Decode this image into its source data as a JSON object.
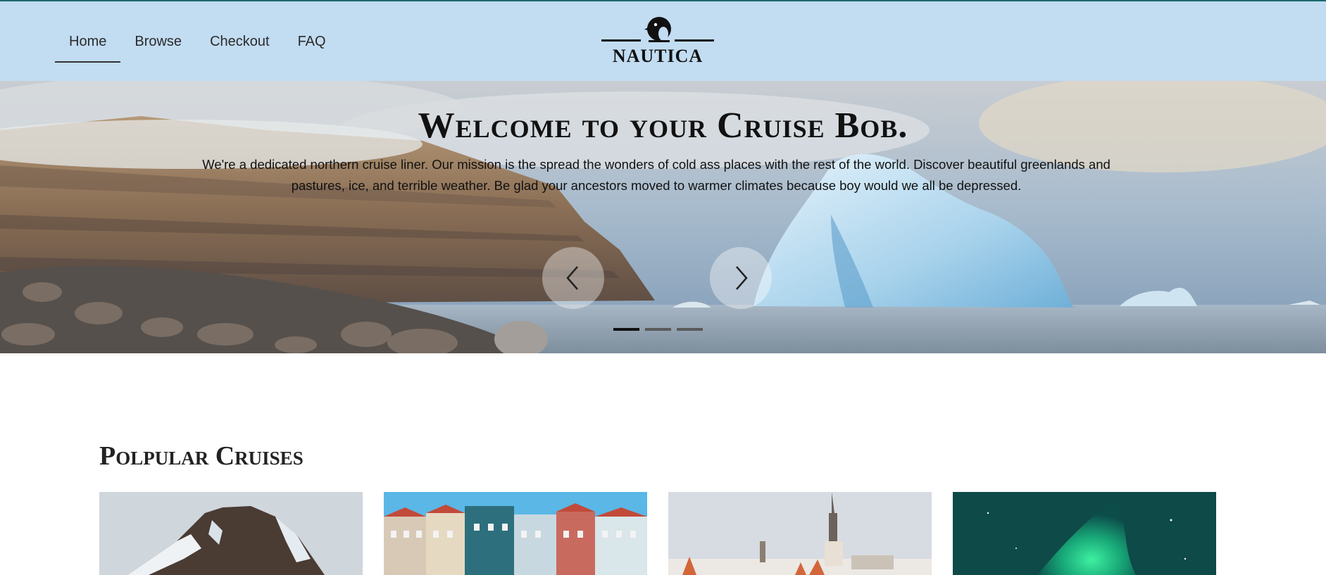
{
  "nav": {
    "items": [
      {
        "label": "Home",
        "active": true
      },
      {
        "label": "Browse",
        "active": false
      },
      {
        "label": "Checkout",
        "active": false
      },
      {
        "label": "FAQ",
        "active": false
      }
    ]
  },
  "logo": {
    "text": "NAUTICA",
    "icon": "penguin-logo-icon"
  },
  "hero": {
    "title": "Welcome to your Cruise Bob.",
    "text": "We're a dedicated northern cruise liner. Our mission is the spread the wonders of cold ass places with the rest of the world. Discover beautiful greenlands and pastures, ice, and terrible weather. Be glad your ancestors moved to warmer climates because boy would we all be depressed.",
    "prev_icon": "chevron-left-icon",
    "next_icon": "chevron-right-icon",
    "slides_count": 3,
    "active_slide": 1
  },
  "popular": {
    "title": "Polpular Cruises",
    "cards": [
      {
        "image": "snowy-mountain-image"
      },
      {
        "image": "colorful-harbor-houses-image"
      },
      {
        "image": "old-town-spire-image"
      },
      {
        "image": "northern-lights-image"
      }
    ]
  },
  "colors": {
    "header_bg": "#c2dcf2",
    "top_line": "#1d6b6b",
    "text": "#222222"
  }
}
